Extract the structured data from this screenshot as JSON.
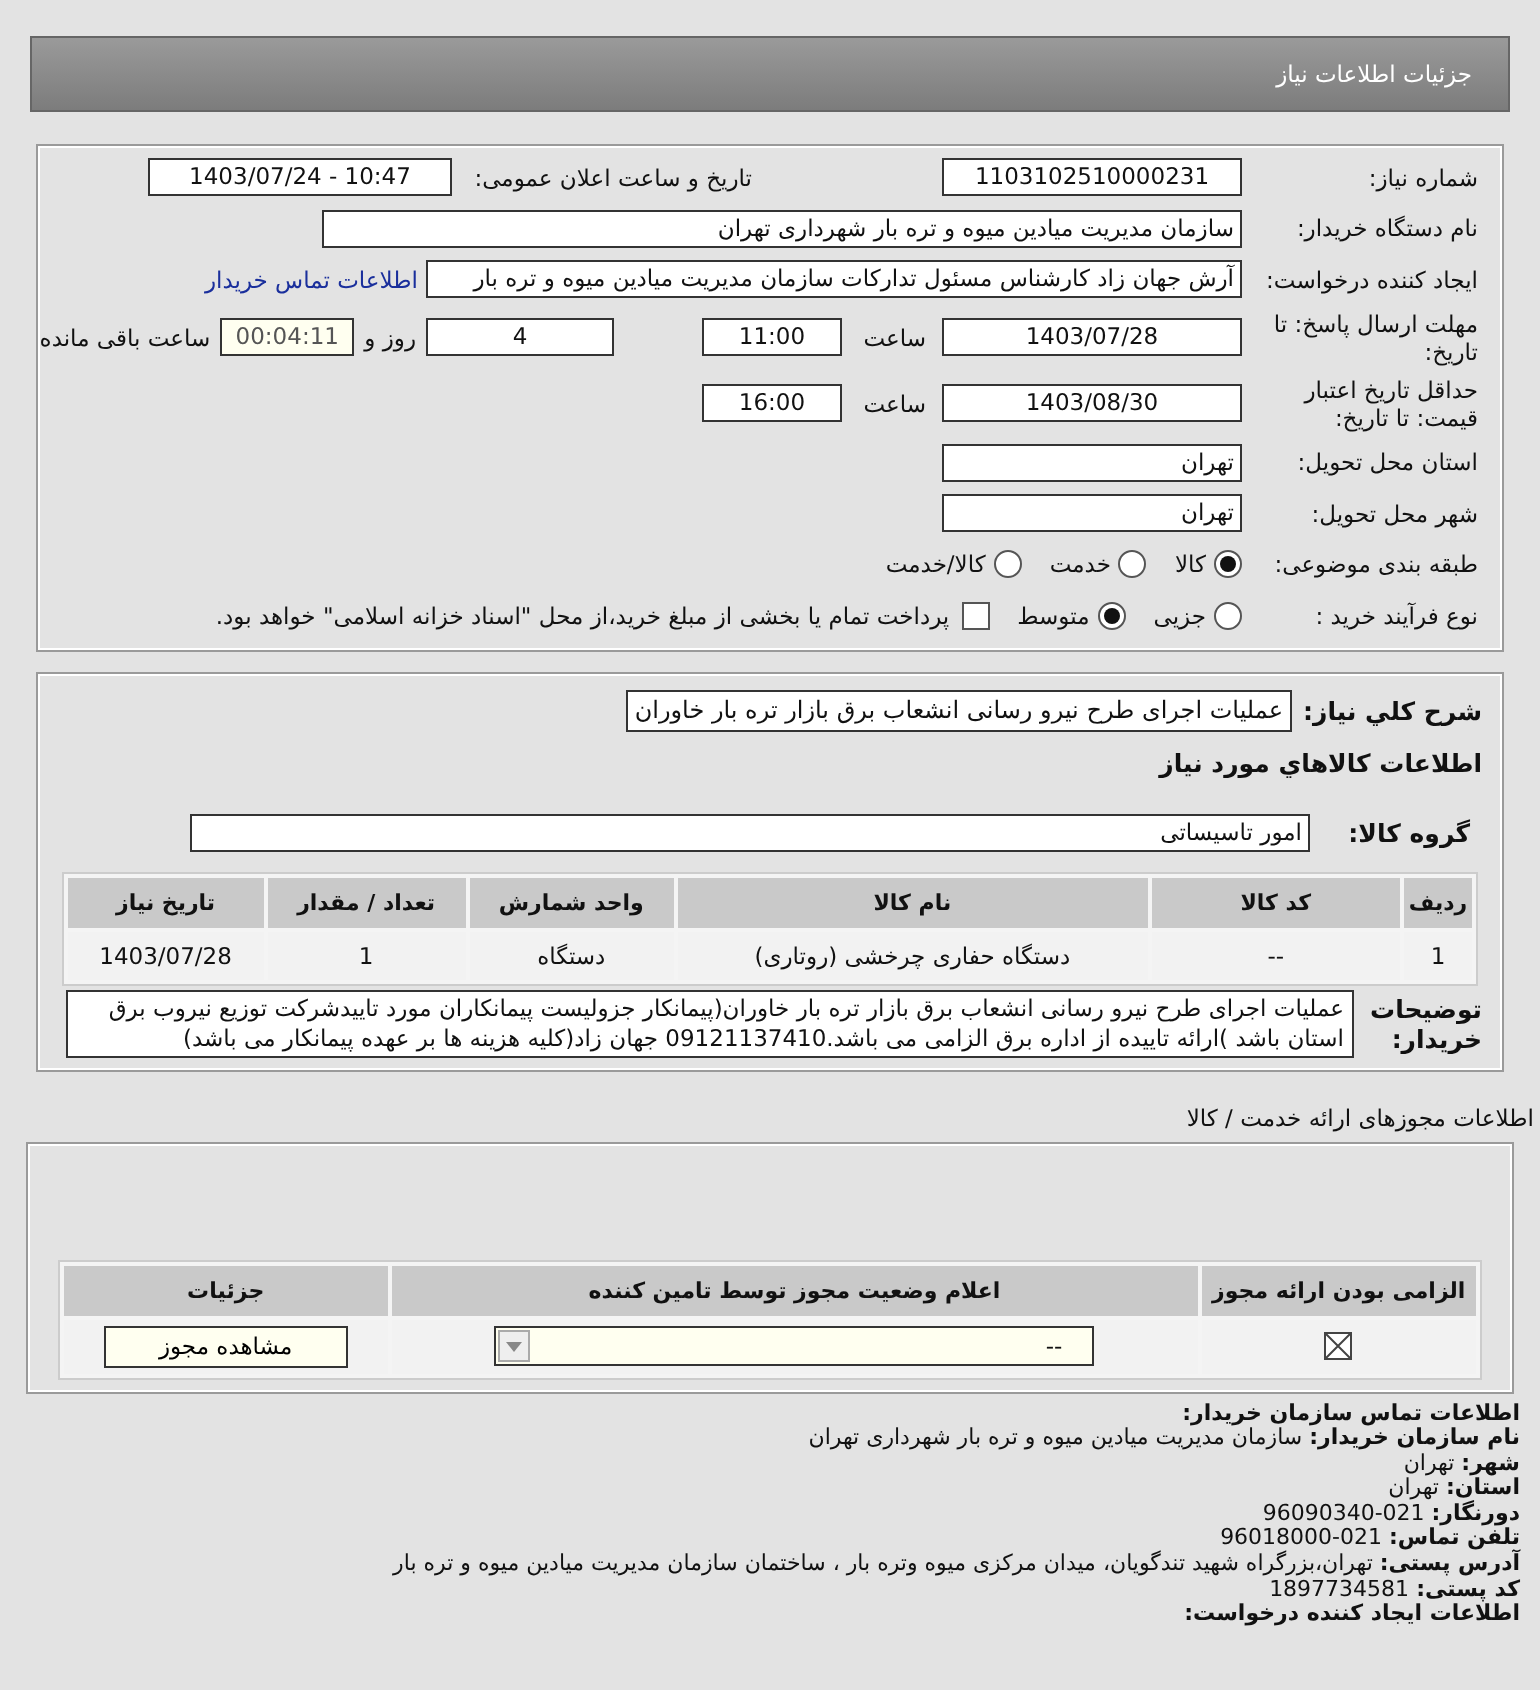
{
  "header": {
    "title": "جزئیات اطلاعات نیاز"
  },
  "form": {
    "need_number": {
      "label": "شماره نیاز:",
      "value": "1103102510000231"
    },
    "announce": {
      "label": "تاریخ و ساعت اعلان عمومی:",
      "value": "1403/07/24 - 10:47"
    },
    "buyer_org": {
      "label": "نام دستگاه خریدار:",
      "value": "سازمان مدیریت میادین میوه و تره بار شهرداری تهران"
    },
    "requester": {
      "label": "ایجاد کننده درخواست:",
      "value": "آرش جهان زاد کارشناس مسئول تدارکات سازمان مدیریت میادین میوه و تره بار",
      "link": "اطلاعات تماس خریدار"
    },
    "deadline": {
      "label": "مهلت ارسال پاسخ: تا تاریخ:",
      "date": "1403/07/28",
      "time_label": "ساعت",
      "time": "11:00",
      "days": "4",
      "days_label": "روز و",
      "remaining": "00:04:11",
      "remaining_label": "ساعت باقی مانده"
    },
    "validity": {
      "label": "حداقل تاریخ اعتبار قیمت: تا تاریخ:",
      "date": "1403/08/30",
      "time_label": "ساعت",
      "time": "16:00"
    },
    "province": {
      "label": "استان محل تحویل:",
      "value": "تهران"
    },
    "city": {
      "label": "شهر محل تحویل:",
      "value": "تهران"
    },
    "category": {
      "label": "طبقه بندی موضوعی:",
      "options": [
        {
          "label": "کالا",
          "selected": true
        },
        {
          "label": "خدمت",
          "selected": false
        },
        {
          "label": "کالا/خدمت",
          "selected": false
        }
      ]
    },
    "purchase_type": {
      "label": "نوع فرآیند خرید :",
      "options": [
        {
          "label": "جزیی",
          "selected": false
        },
        {
          "label": "متوسط",
          "selected": true
        }
      ],
      "payment": {
        "label": "پرداخت تمام یا بخشی از مبلغ خرید،از محل \"اسناد خزانه اسلامی\" خواهد بود.",
        "checked": false
      }
    }
  },
  "goods": {
    "description": {
      "label": "شرح کلي نياز:",
      "value": "عملیات اجرای طرح نیرو رسانی انشعاب برق بازار تره بار خاوران"
    },
    "title": "اطلاعات کالاهاي مورد نياز",
    "group": {
      "label": "گروه کالا:",
      "value": "امور تاسیساتی"
    },
    "table": {
      "columns": [
        "ردیف",
        "کد کالا",
        "نام کالا",
        "واحد شمارش",
        "تعداد / مقدار",
        "تاریخ نیاز"
      ],
      "rows": [
        [
          "1",
          "--",
          "دستگاه حفاری چرخشی (روتاری)",
          "دستگاه",
          "1",
          "1403/07/28"
        ]
      ]
    },
    "notes": {
      "label": "توضیحات خریدار:",
      "value": "عملیات اجرای طرح نیرو رسانی انشعاب برق بازار تره بار خاوران(پیمانکار جزولیست پیمانکاران مورد تاییدشرکت توزیع نیروب برق استان باشد )ارائه تاییده از اداره برق الزامی می باشد.09121137410 جهان زاد(کلیه هزینه ها بر عهده پیمانکار می باشد)"
    }
  },
  "permits": {
    "title": "اطلاعات مجوزهای ارائه خدمت / کالا",
    "columns": [
      "الزامی بودن ارائه مجوز",
      "اعلام وضعیت مجوز توسط تامین کننده",
      "جزئیات"
    ],
    "rows": [
      {
        "required": true,
        "status": "--",
        "details": "مشاهده مجوز"
      }
    ]
  },
  "contact": {
    "title": "اطلاعات تماس سازمان خریدار:",
    "lines": [
      {
        "label": "نام سازمان خریدار:",
        "value": "سازمان مدیریت میادین میوه و تره بار شهرداری تهران"
      },
      {
        "label": "شهر:",
        "value": "تهران"
      },
      {
        "label": "استان:",
        "value": "تهران"
      },
      {
        "label": "دورنگار:",
        "value": "96090340-021"
      },
      {
        "label": "تلفن تماس:",
        "value": "96018000-021"
      },
      {
        "label": "آدرس پستی:",
        "value": "تهران،بزرگراه شهید تندگویان، میدان مرکزی میوه وتره بار ، ساختمان سازمان مدیریت میادین میوه و تره بار"
      },
      {
        "label": "کد پستی:",
        "value": "1897734581"
      }
    ],
    "footer": "اطلاعات ایجاد کننده درخواست:"
  }
}
